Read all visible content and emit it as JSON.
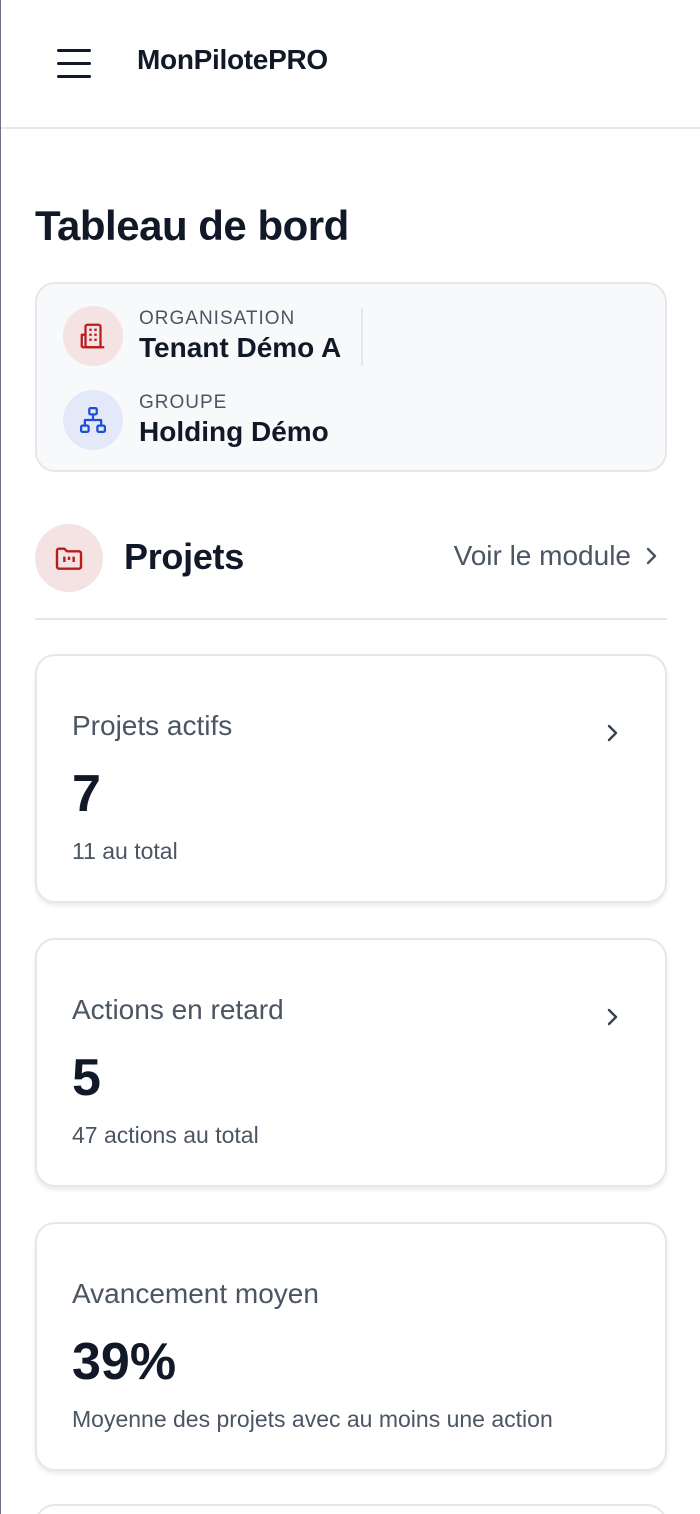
{
  "header": {
    "app_title": "MonPilotePRO",
    "menu_icon": "hamburger-menu-icon"
  },
  "page": {
    "title": "Tableau de bord"
  },
  "context": {
    "organisation": {
      "label": "ORGANISATION",
      "value": "Tenant Démo A",
      "icon": "building-icon",
      "color": "#b91c1c"
    },
    "groupe": {
      "label": "GROUPE",
      "value": "Holding Démo",
      "icon": "org-chart-icon",
      "color": "#1d4ed8"
    }
  },
  "module": {
    "title": "Projets",
    "icon": "project-folder-icon",
    "link_label": "Voir le module",
    "accent_color": "#b91c1c"
  },
  "stats": [
    {
      "label": "Projets actifs",
      "value": "7",
      "sub": "11 au total"
    },
    {
      "label": "Actions en retard",
      "value": "5",
      "sub": "47 actions au total"
    },
    {
      "label": "Avancement moyen",
      "value": "39%",
      "sub": "Moyenne des projets avec au moins une action"
    }
  ]
}
